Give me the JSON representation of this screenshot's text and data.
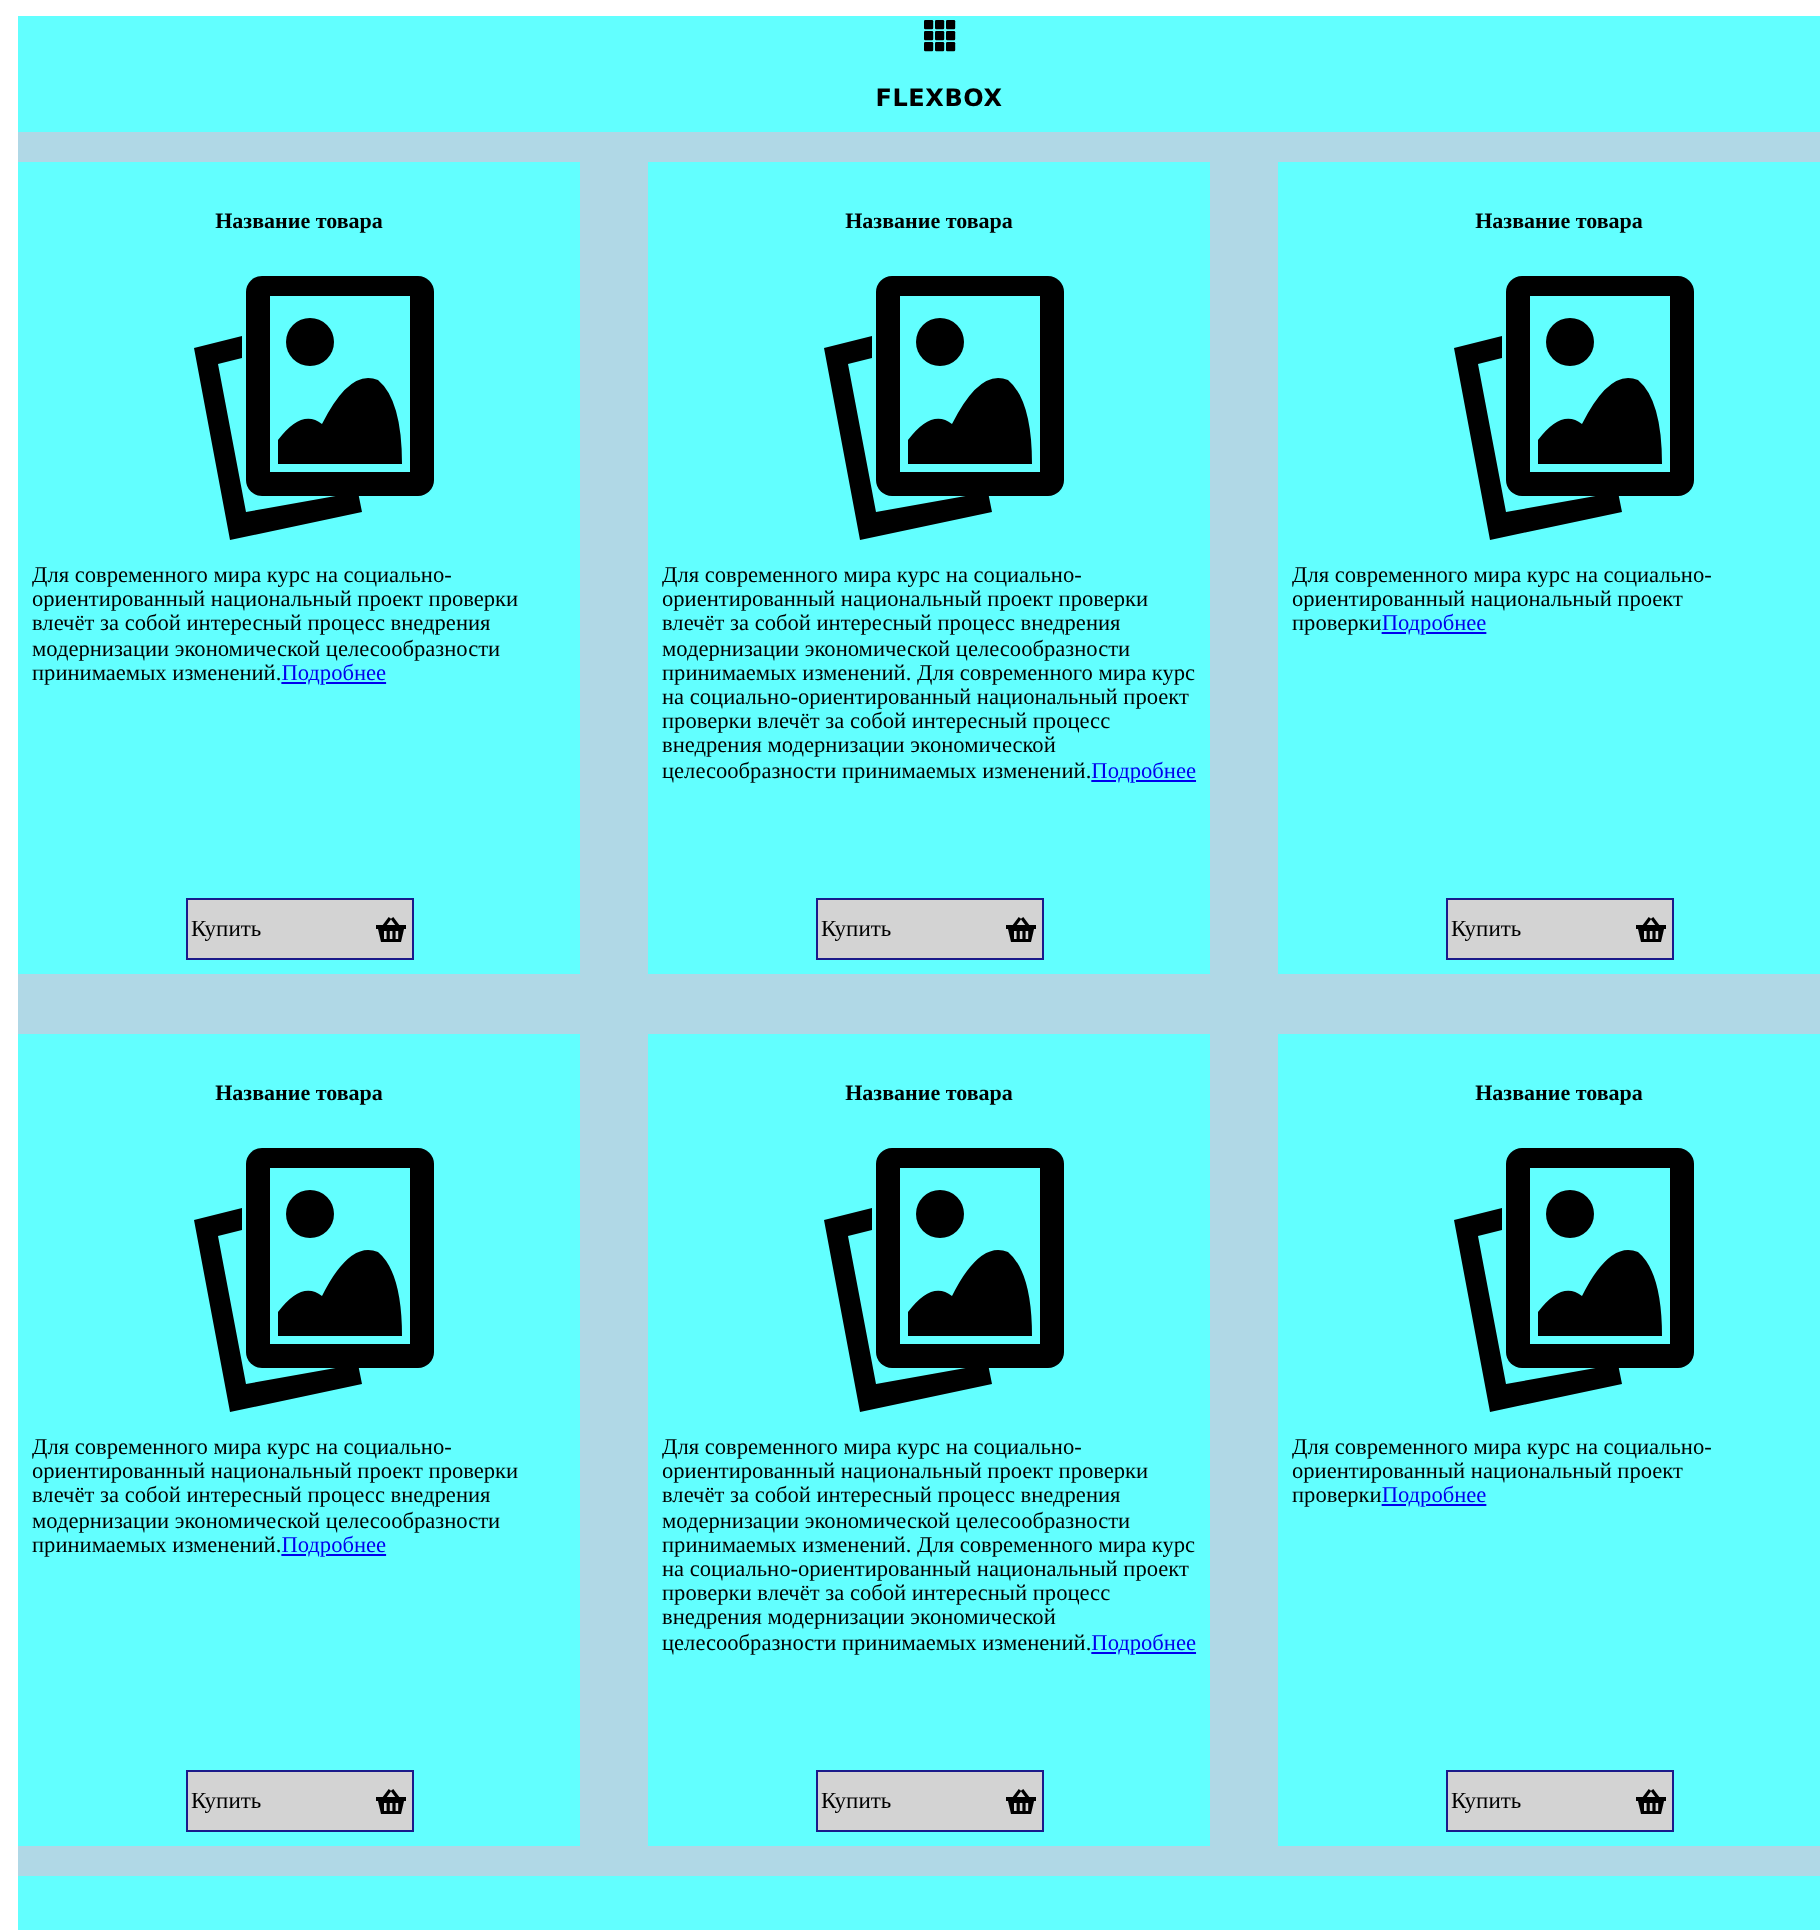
{
  "header": {
    "title": "FLEXBOX"
  },
  "cards": [
    {
      "title": "Название товара",
      "description": "Для современного мира курс на социально-ориентированный национальный проект проверки влечёт за собой интересный процесс внедрения модернизации экономической целесообразности принимаемых изменений.",
      "link": "Подробнее",
      "button": "Купить"
    },
    {
      "title": "Название товара",
      "description": "Для современного мира курс на социально-ориентированный национальный проект проверки влечёт за собой интересный процесс внедрения модернизации экономической целесообразности принимаемых изменений. Для современного мира курс на социально-ориентированный национальный проект проверки влечёт за собой интересный процесс внедрения модернизации экономической целесообразности принимаемых изменений.",
      "link": "Подробнее",
      "button": "Купить"
    },
    {
      "title": "Название товара",
      "description": "Для современного мира курс на социально-ориентированный национальный проект проверки",
      "link": "Подробнее",
      "button": "Купить"
    },
    {
      "title": "Название товара",
      "description": "Для современного мира курс на социально-ориентированный национальный проект проверки влечёт за собой интересный процесс внедрения модернизации экономической целесообразности принимаемых изменений.",
      "link": "Подробнее",
      "button": "Купить"
    },
    {
      "title": "Название товара",
      "description": "Для современного мира курс на социально-ориентированный национальный проект проверки влечёт за собой интересный процесс внедрения модернизации экономической целесообразности принимаемых изменений. Для современного мира курс на социально-ориентированный национальный проект проверки влечёт за собой интересный процесс внедрения модернизации экономической целесообразности принимаемых изменений.",
      "link": "Подробнее",
      "button": "Купить"
    },
    {
      "title": "Название товара",
      "description": "Для современного мира курс на социально-ориентированный национальный проект проверки",
      "link": "Подробнее",
      "button": "Купить"
    }
  ]
}
